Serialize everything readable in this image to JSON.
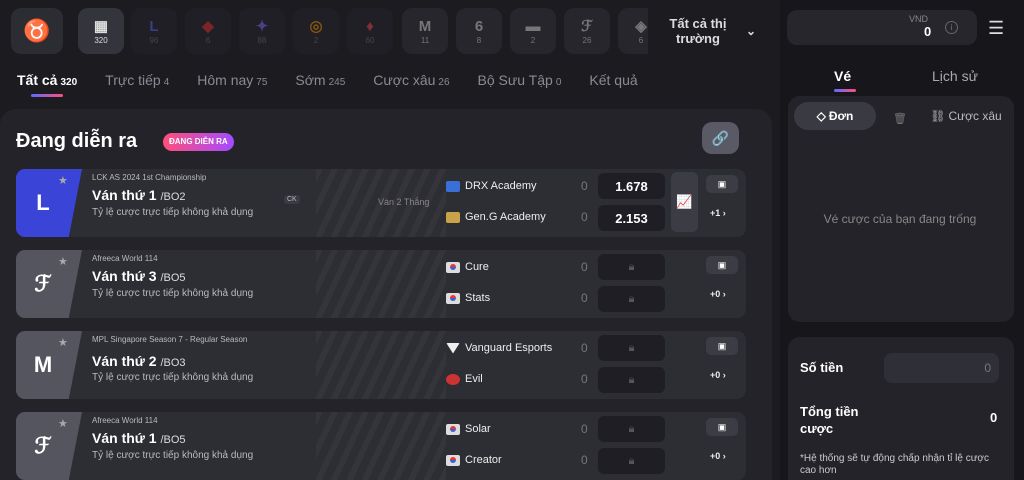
{
  "games": [
    {
      "icon": "L",
      "count": "96"
    },
    {
      "icon": "◆",
      "count": "6"
    },
    {
      "icon": "✦",
      "count": "88"
    },
    {
      "icon": "◎",
      "count": "2"
    },
    {
      "icon": "♦",
      "count": "60"
    },
    {
      "icon": "M",
      "count": "11"
    },
    {
      "icon": "6",
      "count": "8"
    },
    {
      "icon": "▬",
      "count": "2"
    },
    {
      "icon": "ℱ",
      "count": "26"
    },
    {
      "icon": "◈",
      "count": "6"
    }
  ],
  "all_games": {
    "count": "320"
  },
  "market": {
    "label": "Tất cả thị trường"
  },
  "tabs": [
    {
      "label": "Tất cả",
      "count": "320"
    },
    {
      "label": "Trực tiếp",
      "count": "4"
    },
    {
      "label": "Hôm nay",
      "count": "75"
    },
    {
      "label": "Sớm",
      "count": "245"
    },
    {
      "label": "Cược xâu",
      "count": "26"
    },
    {
      "label": "Bộ Sưu Tập",
      "count": "0"
    },
    {
      "label": "Kết quả",
      "count": ""
    }
  ],
  "live": {
    "title": "Đang diễn ra",
    "badge": "ĐANG DIỄN RA"
  },
  "matches": [
    {
      "league": "LCK AS 2024 1st Championship",
      "round": "Ván thứ 1",
      "bo": "/BO2",
      "note": "Tỷ lệ cược trực tiếp không khả dụng",
      "ck": "CK",
      "win": "Ván 2 Thắng",
      "team1": "DRX Academy",
      "team2": "Gen.G Academy",
      "score1": "0",
      "score2": "0",
      "odds1": "1.678",
      "odds2": "2.153",
      "more": "+1 ›"
    },
    {
      "league": "Afreeca World 114",
      "round": "Ván thứ 3",
      "bo": "/BO5",
      "note": "Tỷ lệ cược trực tiếp không khả dụng",
      "team1": "Cure",
      "team2": "Stats",
      "score1": "0",
      "score2": "0",
      "more": "+0 ›"
    },
    {
      "league": "MPL Singapore Season 7 - Regular Season",
      "round": "Ván thứ 2",
      "bo": "/BO3",
      "note": "Tỷ lệ cược trực tiếp không khả dụng",
      "team1": "Vanguard Esports",
      "team2": "Evil",
      "score1": "0",
      "score2": "0",
      "more": "+0 ›"
    },
    {
      "league": "Afreeca World 114",
      "round": "Ván thứ 1",
      "bo": "/BO5",
      "note": "Tỷ lệ cược trực tiếp không khả dụng",
      "team1": "Solar",
      "team2": "Creator",
      "score1": "0",
      "score2": "0",
      "more": "+0 ›"
    }
  ],
  "wallet": {
    "currency": "VND",
    "amount": "0"
  },
  "right_tabs": {
    "ticket": "Vé",
    "history": "Lịch sử"
  },
  "slip": {
    "single": "Đơn",
    "combo": "Cược xâu",
    "empty": "Vé cược của bạn đang trống"
  },
  "stake": {
    "label": "Số tiền",
    "placeholder": "0",
    "total_label": "Tổng tiền cược",
    "total_value": "0",
    "auto_note": "*Hệ thống sẽ tự động chấp nhận tỉ lệ cược cao hơn"
  },
  "colors": {
    "accent_start": "#5b6cff",
    "accent_end": "#ff4f7b",
    "lck_blue": "#3a44d6"
  }
}
